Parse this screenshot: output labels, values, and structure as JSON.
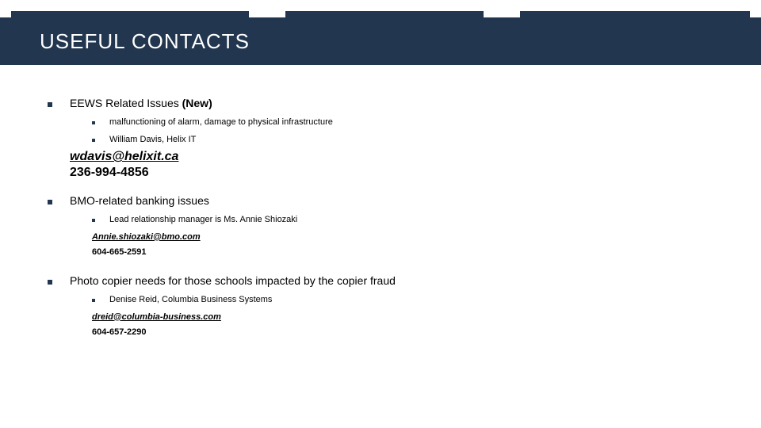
{
  "header": {
    "title": "USEFUL CONTACTS"
  },
  "sections": {
    "s1": {
      "label": "EEWS Related Issues",
      "tag": "(New)",
      "sub1": "malfunctioning of alarm, damage to physical infrastructure",
      "sub2": "William Davis, Helix IT",
      "email": "wdavis@helixit.ca",
      "phone": "236-994-4856"
    },
    "s2": {
      "label": "BMO-related banking issues",
      "sub1": "Lead relationship manager is Ms. Annie Shiozaki",
      "email": "Annie.shiozaki@bmo.com",
      "phone": "604-665-2591"
    },
    "s3": {
      "label": "Photo copier needs for those schools impacted by the copier fraud",
      "sub1": "Denise Reid, Columbia Business Systems",
      "email": "dreid@columbia-business.com",
      "phone": "604-657-2290"
    }
  }
}
